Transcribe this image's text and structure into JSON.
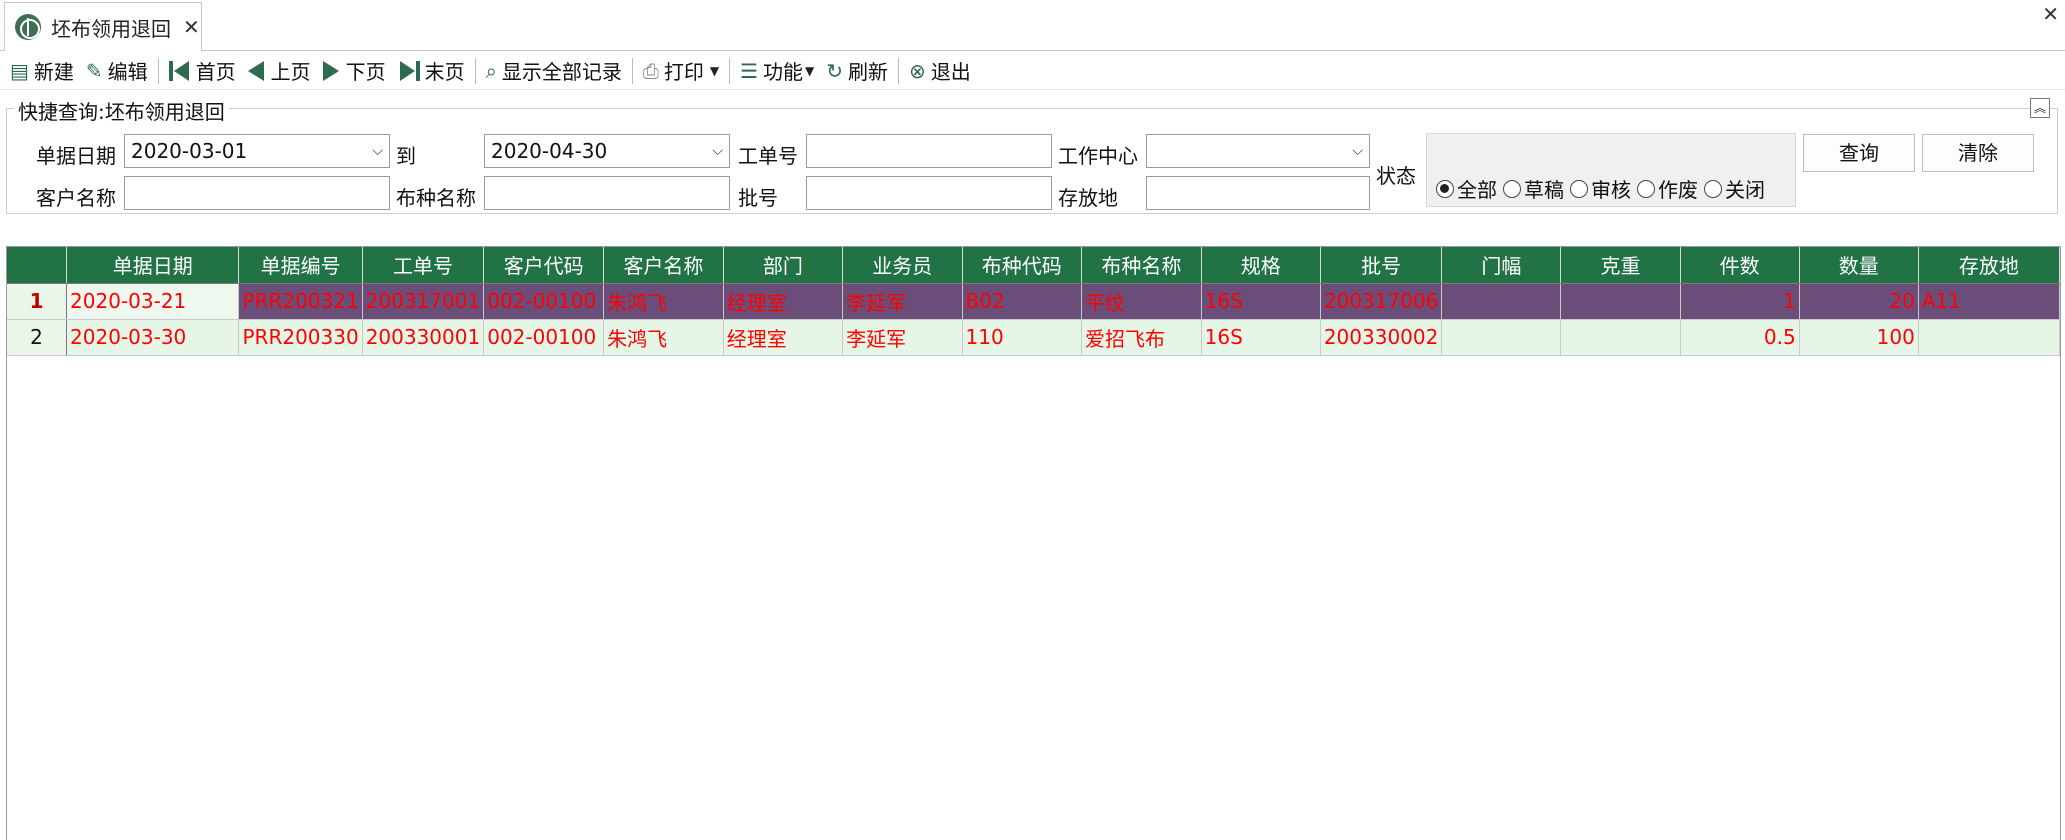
{
  "tab": {
    "label": "坯布领用退回",
    "close": "✕"
  },
  "window_close": "✕",
  "toolbar": {
    "new": "新建",
    "edit": "编辑",
    "first": "首页",
    "prev": "上页",
    "next": "下页",
    "last": "末页",
    "show_all": "显示全部记录",
    "print": "打印",
    "function": "功能",
    "refresh": "刷新",
    "exit": "退出"
  },
  "query": {
    "title": "快捷查询:坯布领用退回",
    "date_label": "单据日期",
    "date_from": "2020-03-01",
    "to_label": "到",
    "date_to": "2020-04-30",
    "work_order_label": "工单号",
    "work_order_value": "",
    "work_center_label": "工作中心",
    "work_center_value": "",
    "status_label": "状态",
    "customer_label": "客户名称",
    "customer_value": "",
    "fabric_label": "布种名称",
    "fabric_value": "",
    "batch_label": "批号",
    "batch_value": "",
    "storage_label": "存放地",
    "storage_value": "",
    "status_options": [
      "全部",
      "草稿",
      "审核",
      "作废",
      "关闭"
    ],
    "status_selected": "全部",
    "search_button": "查询",
    "clear_button": "清除"
  },
  "grid": {
    "columns": [
      "单据日期",
      "单据编号",
      "工单号",
      "客户代码",
      "客户名称",
      "部门",
      "业务员",
      "布种代码",
      "布种名称",
      "规格",
      "批号",
      "门幅",
      "克重",
      "件数",
      "数量",
      "存放地"
    ],
    "rows": [
      {
        "num": "1",
        "cells": [
          "2020-03-21",
          "PRR200321",
          "200317001",
          "002-00100",
          "朱鸿飞",
          "经理室",
          "李延军",
          "B02",
          "平纹",
          "16S",
          "200317006",
          "",
          "",
          "1",
          "20",
          "A11"
        ]
      },
      {
        "num": "2",
        "cells": [
          "2020-03-30",
          "PRR200330",
          "200330001",
          "002-00100",
          "朱鸿飞",
          "经理室",
          "李延军",
          "110",
          "爱招飞布",
          "16S",
          "200330002",
          "",
          "",
          "0.5",
          "100",
          ""
        ]
      }
    ]
  },
  "colors": {
    "header_green": "#217346",
    "selected_row": "#6b4d7a",
    "row_text_red": "#ff0000"
  }
}
